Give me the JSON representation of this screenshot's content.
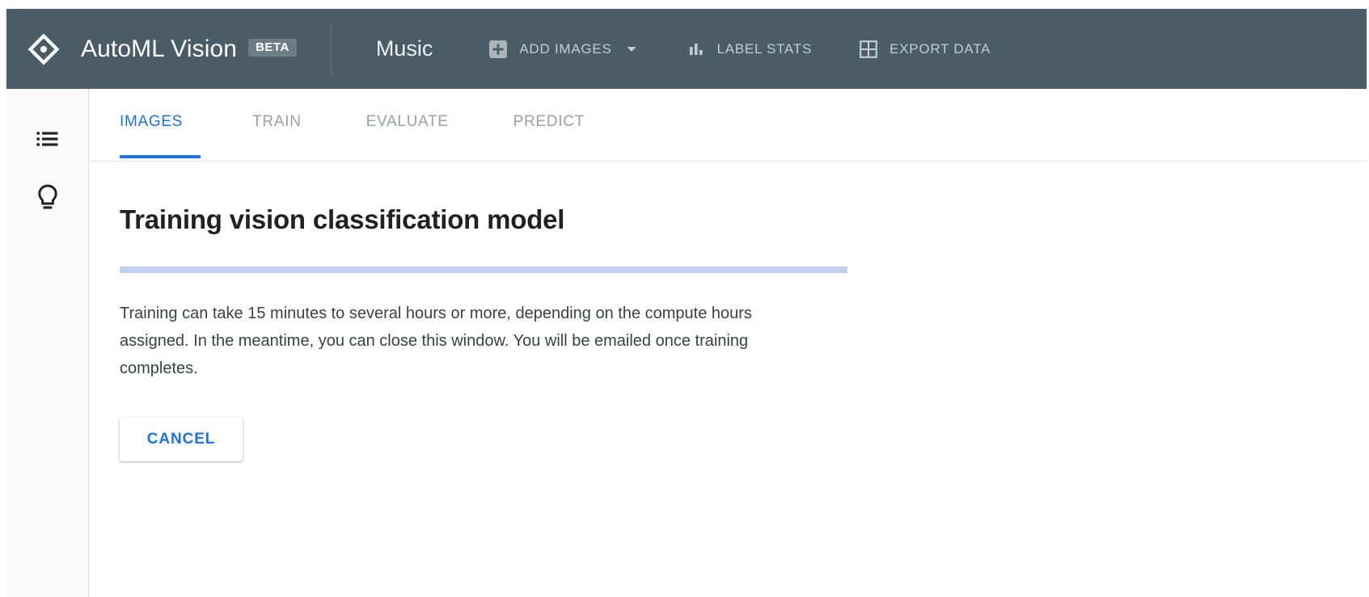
{
  "appbar": {
    "logo_icon": "diamond-eye-logo-icon",
    "brand": "AutoML Vision",
    "beta_badge": "BETA",
    "dataset_name": "Music",
    "background_color": "#4a5c66",
    "actions": [
      {
        "id": "add-images",
        "label": "ADD IMAGES",
        "icon": "plus-box-icon",
        "has_caret": true
      },
      {
        "id": "label-stats",
        "label": "LABEL STATS",
        "icon": "bar-chart-icon",
        "has_caret": false
      },
      {
        "id": "export-data",
        "label": "EXPORT DATA",
        "icon": "grid-table-icon",
        "has_caret": false
      }
    ]
  },
  "rail": {
    "items": [
      {
        "id": "list",
        "icon": "bulleted-list-icon",
        "label": "Datasets"
      },
      {
        "id": "tips",
        "icon": "lightbulb-icon",
        "label": "Tips"
      }
    ]
  },
  "tabs": {
    "active": "IMAGES",
    "items": [
      {
        "id": "images",
        "label": "IMAGES"
      },
      {
        "id": "train",
        "label": "TRAIN"
      },
      {
        "id": "evaluate",
        "label": "EVALUATE"
      },
      {
        "id": "predict",
        "label": "PREDICT"
      }
    ]
  },
  "main": {
    "heading": "Training vision classification model",
    "progress": {
      "mode": "indeterminate",
      "percent": 100,
      "fill_color": "#c0d0f0"
    },
    "body": "Training can take 15 minutes to several hours or more, depending on the compute hours assigned. In the meantime, you can close this window. You will be emailed once training completes.",
    "cancel_label": "CANCEL"
  },
  "colors": {
    "accent_blue": "#1a73e8",
    "appbar_dark": "#4a5c66",
    "progress_blue": "#c0d0f0",
    "rail_bg": "#fafafa"
  }
}
